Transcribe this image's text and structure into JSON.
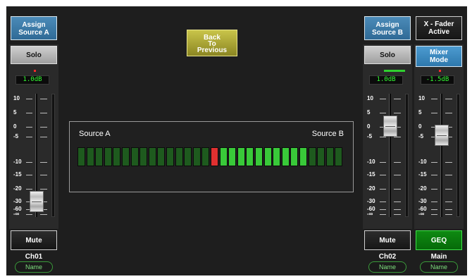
{
  "top_buttons": {
    "assign_a": "Assign\nSource A",
    "assign_b": "Assign\nSource B",
    "xfader_active": "X - Fader\nActive",
    "back": "Back\nTo\nPrevious"
  },
  "channels": [
    {
      "id": "a",
      "solo": "Solo",
      "gain": "1.0dB",
      "mute": "Mute",
      "name": "Ch01",
      "name_btn": "Name",
      "fader_level_db": -25,
      "level_leds": "single-red"
    },
    {
      "id": "b",
      "solo": "Solo",
      "gain": "1.0dB",
      "mute": "Mute",
      "name": "Ch02",
      "name_btn": "Name",
      "fader_level_db": 0,
      "level_leds": "green-bar"
    },
    {
      "id": "main",
      "mode": "Mixer\nMode",
      "gain": "-1.5dB",
      "geq": "GEQ",
      "name": "Main",
      "name_btn": "Name",
      "fader_level_db": -3,
      "level_leds": "single-red"
    }
  ],
  "scale_labels": [
    "10",
    "5",
    "0",
    "-5",
    "-10",
    "-15",
    "-20",
    "-30",
    "-60",
    "-∞"
  ],
  "crossfader": {
    "label_left": "Source A",
    "label_right": "Source B",
    "segment_count": 30,
    "position_index": 15,
    "lit_range": [
      16,
      25
    ],
    "colors": {
      "off": "#1e5a1e",
      "lit": "#39c939",
      "position": "#e03030"
    }
  },
  "colors": {
    "background": "#1e1e1e",
    "assign_blue": "#3a7aa8",
    "back_yellow": "#a9a436",
    "geq_green": "#0a7a0e"
  }
}
